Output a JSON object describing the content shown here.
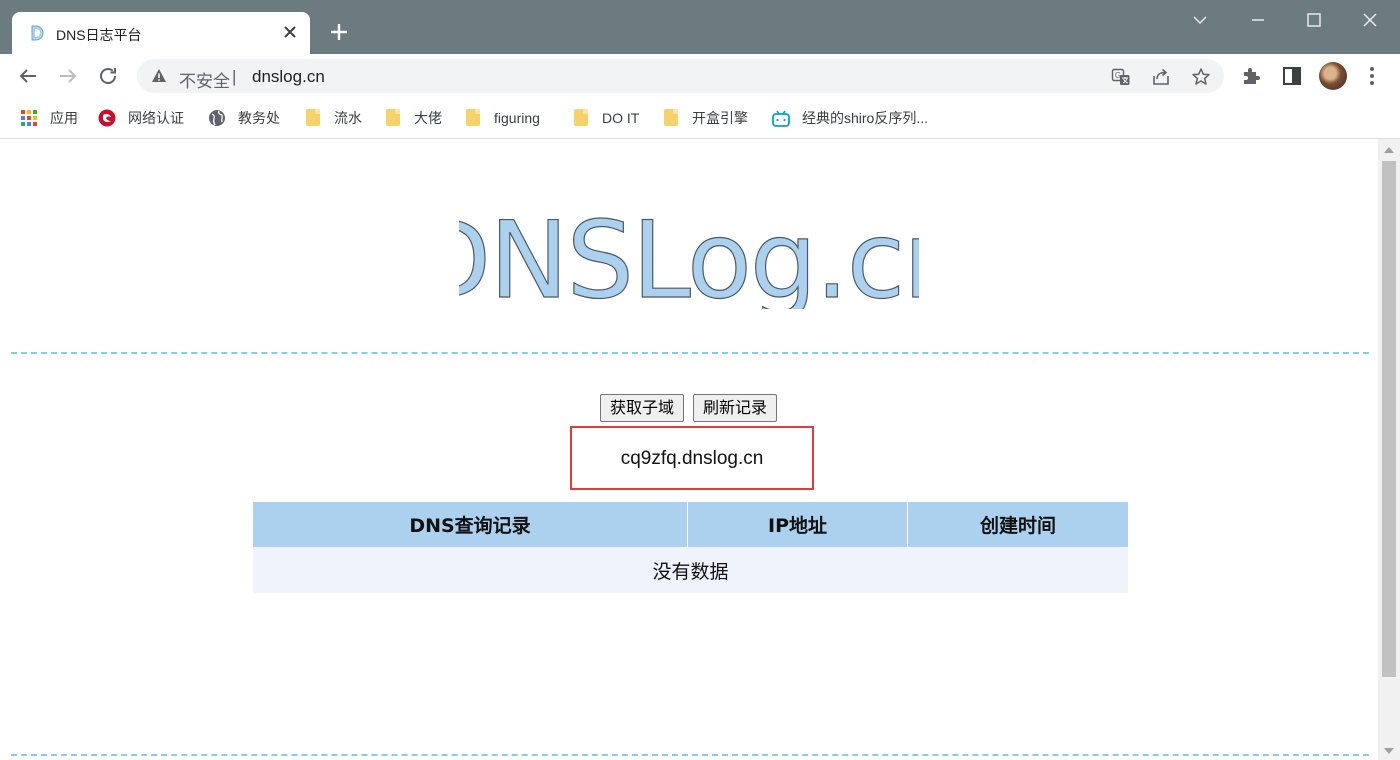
{
  "tab": {
    "title": "DNS日志平台"
  },
  "address_bar": {
    "security": "不安全",
    "url": "dnslog.cn"
  },
  "bookmarks": [
    {
      "label": "应用",
      "icon": "apps-grid-icon"
    },
    {
      "label": "网络认证",
      "icon": "red-logo-icon"
    },
    {
      "label": "教务处",
      "icon": "globe-icon"
    },
    {
      "label": "流水",
      "icon": "folder-icon"
    },
    {
      "label": "大佬",
      "icon": "folder-icon"
    },
    {
      "label": "figuring",
      "icon": "folder-icon"
    },
    {
      "label": "DO IT",
      "icon": "folder-icon"
    },
    {
      "label": "开盒引擎",
      "icon": "folder-icon"
    },
    {
      "label": "经典的shiro反序列...",
      "icon": "bilibili-icon"
    }
  ],
  "page": {
    "logo_text": "DNSLog.cn",
    "buttons": {
      "get_subdomain": "获取子域",
      "refresh": "刷新记录"
    },
    "subdomain": "cq9zfq.dnslog.cn",
    "table": {
      "headers": [
        "DNS查询记录",
        "IP地址",
        "创建时间"
      ],
      "empty_message": "没有数据"
    }
  },
  "colors": {
    "title_bar": "#6b7b80",
    "logo_fill": "#acd1ee",
    "divider": "#87cde6",
    "highlight_box": "#e03d3d",
    "table_header": "#acd1ee",
    "table_row": "#eef3fc"
  }
}
